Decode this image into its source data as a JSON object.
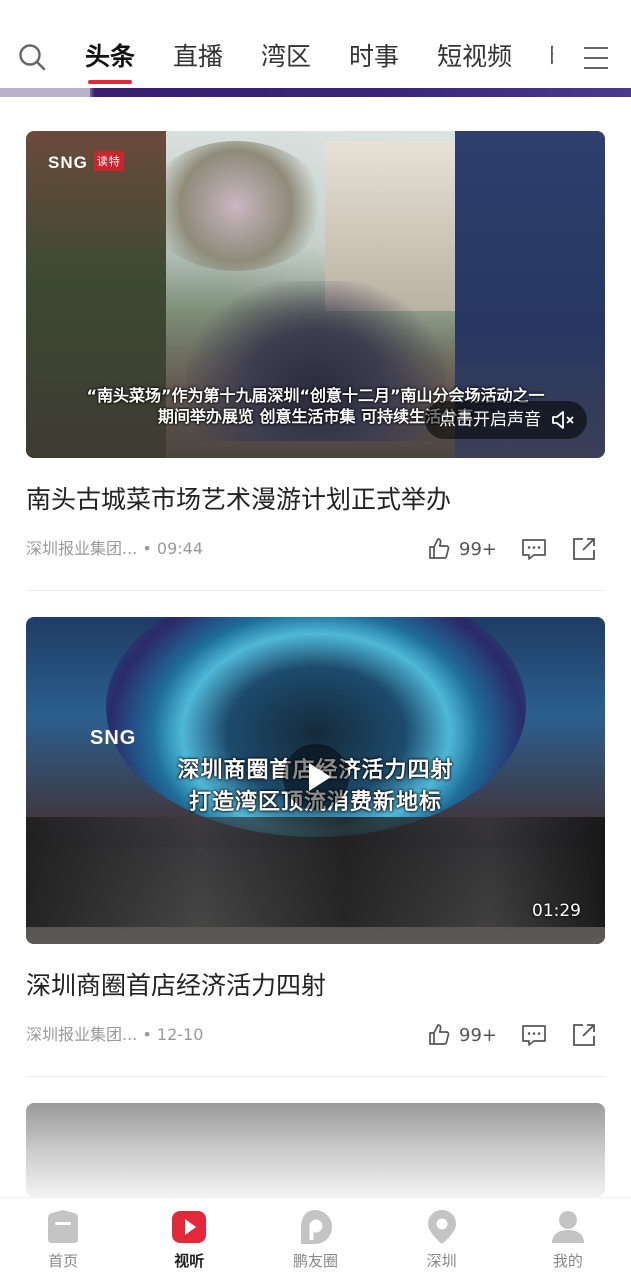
{
  "top_nav": {
    "tabs": [
      {
        "label": "头条",
        "active": true
      },
      {
        "label": "直播",
        "active": false
      },
      {
        "label": "湾区",
        "active": false
      },
      {
        "label": "时事",
        "active": false
      },
      {
        "label": "短视频",
        "active": false
      },
      {
        "label": "晚",
        "active": false
      }
    ]
  },
  "feed": [
    {
      "logo_text": "SNG",
      "logo_badge": "读特",
      "caption_lines": [
        "“南头菜场”作为第十九届深圳“创意十二月”南山分会场活动之一",
        "期间举办展览 创意生活市集 可持续生活分享"
      ],
      "sound_label": "点击开启声音",
      "title": "南头古城菜市场艺术漫游计划正式举办",
      "source": "深圳报业集团...",
      "time": "• 09:44",
      "likes": "99+"
    },
    {
      "logo_text": "SNG",
      "caption_lines": [
        "深圳商圈首店经济活力四射",
        "打造湾区顶流消费新地标"
      ],
      "duration": "01:29",
      "title": "深圳商圈首店经济活力四射",
      "source": "深圳报业集团...",
      "time": "• 12-10",
      "likes": "99+"
    }
  ],
  "bottom_nav": {
    "items": [
      {
        "label": "首页",
        "icon": "home-icon",
        "active": false
      },
      {
        "label": "视听",
        "icon": "play-icon",
        "active": true
      },
      {
        "label": "鹏友圈",
        "icon": "circle-p-icon",
        "active": false
      },
      {
        "label": "深圳",
        "icon": "location-icon",
        "active": false
      },
      {
        "label": "我的",
        "icon": "user-icon",
        "active": false
      }
    ]
  },
  "colors": {
    "accent": "#e3283a",
    "text": "#222222",
    "meta": "#9a9a9a",
    "icon_gray": "#c4c4c4"
  }
}
